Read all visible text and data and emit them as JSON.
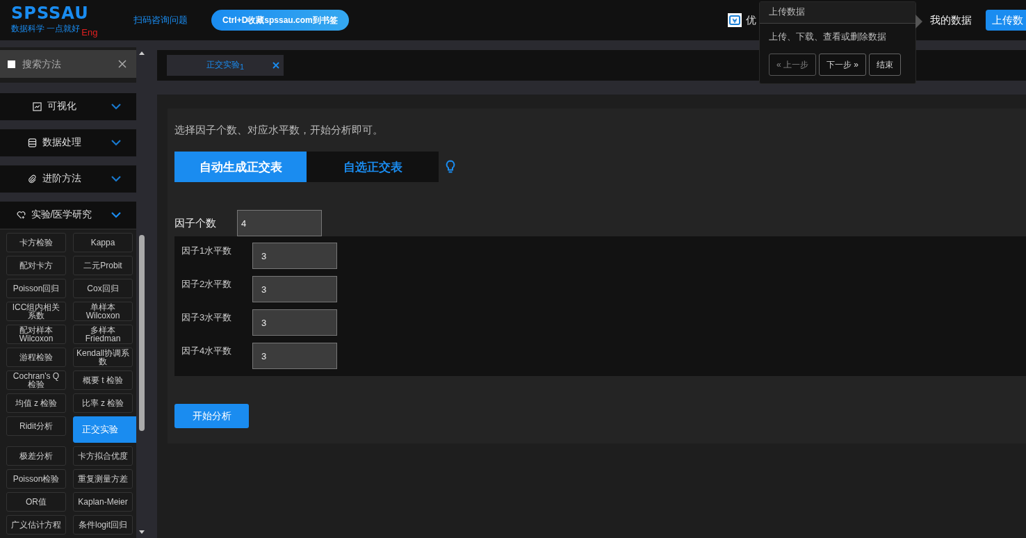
{
  "header": {
    "logo": "SPSSAU",
    "slogan": "数据科学 一点就好",
    "lang_link": "Eng",
    "scan_link": "扫码咨询问题",
    "bookmark_button": "Ctrl+D收藏spssau.com到书签",
    "promo_link": "优",
    "my_data_link": "我的数据",
    "upload_button": "上传数"
  },
  "tour_popover": {
    "title": "上传数据",
    "text": "上传、下载、查看或删除数据",
    "buttons": [
      {
        "label": "« 上一步",
        "disabled": true
      },
      {
        "label": "下一步 »",
        "disabled": false
      },
      {
        "label": "结束",
        "disabled": false
      }
    ]
  },
  "sidebar": {
    "search": {
      "placeholder": "搜索方法"
    },
    "categories": [
      {
        "label": "可视化",
        "kind": "chart",
        "expanded": false
      },
      {
        "label": "数据处理",
        "kind": "database",
        "expanded": false
      },
      {
        "label": "进阶方法",
        "kind": "clip",
        "expanded": false
      },
      {
        "label": "实验/医学研究",
        "kind": "heart",
        "expanded": true
      }
    ],
    "methods": [
      {
        "label": "卡方检验",
        "selected": false
      },
      {
        "label": "Kappa",
        "selected": false
      },
      {
        "label": "配对卡方",
        "selected": false
      },
      {
        "label": "二元Probit",
        "selected": false
      },
      {
        "label": "Poisson回归",
        "selected": false
      },
      {
        "label": "Cox回归",
        "selected": false
      },
      {
        "label": "ICC组内相关系数",
        "selected": false
      },
      {
        "label": "单样本 Wilcoxon",
        "selected": false
      },
      {
        "label": "配对样本 Wilcoxon",
        "selected": false
      },
      {
        "label": "多样本 Friedman",
        "selected": false
      },
      {
        "label": "游程检验",
        "selected": false
      },
      {
        "label": "Kendall协调系数",
        "selected": false
      },
      {
        "label": "Cochran's Q 检验",
        "selected": false
      },
      {
        "label": "概要 t 检验",
        "selected": false
      },
      {
        "label": "均值 z 检验",
        "selected": false
      },
      {
        "label": "比率 z 检验",
        "selected": false
      },
      {
        "label": "Ridit分析",
        "selected": false
      },
      {
        "label": "正交实验",
        "selected": true
      },
      {
        "label": "极差分析",
        "selected": false
      },
      {
        "label": "卡方拟合优度",
        "selected": false
      },
      {
        "label": "Poisson检验",
        "selected": false
      },
      {
        "label": "重复测量方差",
        "selected": false
      },
      {
        "label": "OR值",
        "selected": false
      },
      {
        "label": "Kaplan-Meier",
        "selected": false
      },
      {
        "label": "广义估计方程",
        "selected": false
      },
      {
        "label": "条件logit回归",
        "selected": false
      }
    ]
  },
  "open_tabs": [
    {
      "label": "正交实验",
      "index": "1",
      "selected": true
    }
  ],
  "panel": {
    "intro": "选择因子个数、对应水平数，开始分析即可。",
    "mode_tabs": [
      {
        "label": "自动生成正交表",
        "selected": true
      },
      {
        "label": "自选正交表",
        "selected": false
      }
    ],
    "factor_count": {
      "label": "因子个数",
      "value": "4"
    },
    "levels": [
      {
        "label": "因子1水平数",
        "value": "3"
      },
      {
        "label": "因子2水平数",
        "value": "3"
      },
      {
        "label": "因子3水平数",
        "value": "3"
      },
      {
        "label": "因子4水平数",
        "value": "3"
      }
    ],
    "start_button": "开始分析"
  }
}
